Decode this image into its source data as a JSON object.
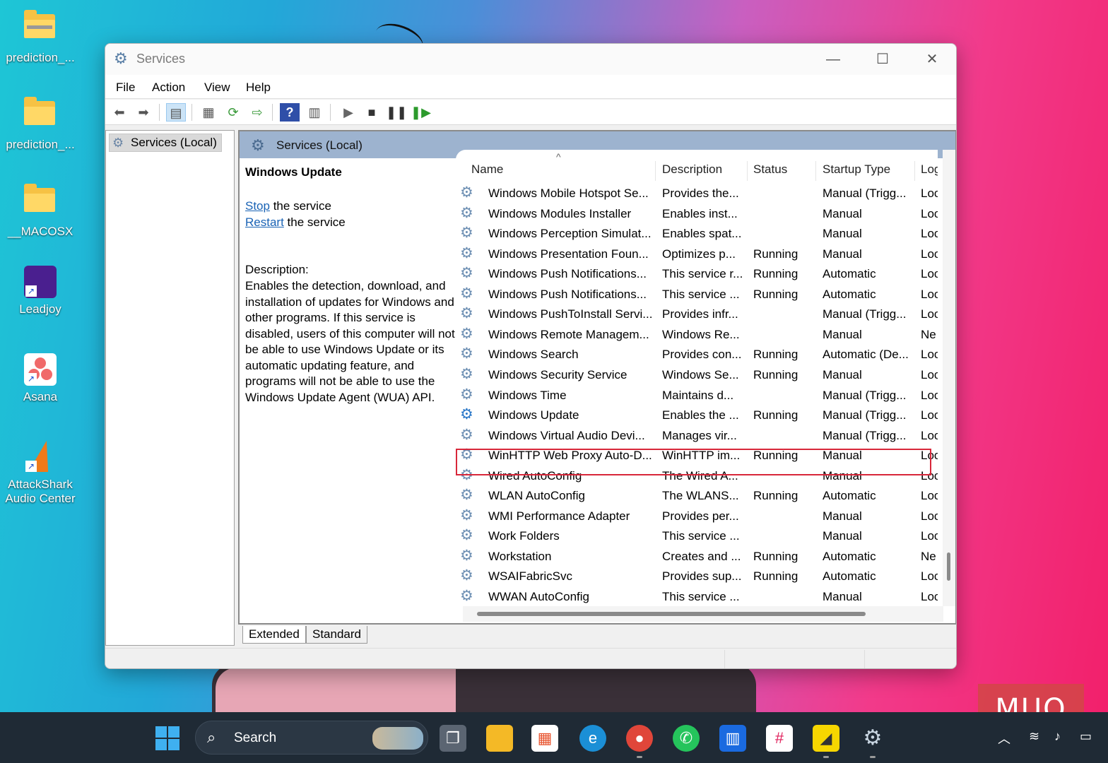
{
  "desktop": {
    "icons": [
      {
        "label": "prediction_...",
        "icon": "zip-folder-icon"
      },
      {
        "label": "prediction_...",
        "icon": "folder-icon"
      },
      {
        "label": "__MACOSX",
        "icon": "folder-icon"
      },
      {
        "label": "Leadjoy",
        "icon": "leadjoy-icon"
      },
      {
        "label": "Asana",
        "icon": "asana-icon"
      },
      {
        "label": "AttackShark Audio Center",
        "icon": "attackshark-icon"
      }
    ]
  },
  "window": {
    "title": "Services",
    "menu": [
      "File",
      "Action",
      "View",
      "Help"
    ],
    "tree_item": "Services (Local)",
    "content_header": "Services (Local)",
    "detail": {
      "service_name": "Windows Update",
      "stop_link": "Stop",
      "stop_rest": " the service",
      "restart_link": "Restart",
      "restart_rest": " the service",
      "description_label": "Description:",
      "description": "Enables the detection, download, and installation of updates for Windows and other programs. If this service is disabled, users of this computer will not be able to use Windows Update or its automatic updating feature, and programs will not be able to use the Windows Update Agent (WUA) API."
    },
    "columns": [
      "Name",
      "Description",
      "Status",
      "Startup Type",
      "Log"
    ],
    "rows": [
      {
        "name": "Windows Mobile Hotspot Se...",
        "description": "Provides the...",
        "status": "",
        "startup": "Manual (Trigg...",
        "logon": "Loc"
      },
      {
        "name": "Windows Modules Installer",
        "description": "Enables inst...",
        "status": "",
        "startup": "Manual",
        "logon": "Loc"
      },
      {
        "name": "Windows Perception Simulat...",
        "description": "Enables spat...",
        "status": "",
        "startup": "Manual",
        "logon": "Loc"
      },
      {
        "name": "Windows Presentation Foun...",
        "description": "Optimizes p...",
        "status": "Running",
        "startup": "Manual",
        "logon": "Loc"
      },
      {
        "name": "Windows Push Notifications...",
        "description": "This service r...",
        "status": "Running",
        "startup": "Automatic",
        "logon": "Loc"
      },
      {
        "name": "Windows Push Notifications...",
        "description": "This service ...",
        "status": "Running",
        "startup": "Automatic",
        "logon": "Loc"
      },
      {
        "name": "Windows PushToInstall Servi...",
        "description": "Provides infr...",
        "status": "",
        "startup": "Manual (Trigg...",
        "logon": "Loc"
      },
      {
        "name": "Windows Remote Managem...",
        "description": "Windows Re...",
        "status": "",
        "startup": "Manual",
        "logon": "Ne"
      },
      {
        "name": "Windows Search",
        "description": "Provides con...",
        "status": "Running",
        "startup": "Automatic (De...",
        "logon": "Loc"
      },
      {
        "name": "Windows Security Service",
        "description": "Windows Se...",
        "status": "Running",
        "startup": "Manual",
        "logon": "Loc"
      },
      {
        "name": "Windows Time",
        "description": "Maintains d...",
        "status": "",
        "startup": "Manual (Trigg...",
        "logon": "Loc"
      },
      {
        "name": "Windows Update",
        "description": "Enables the ...",
        "status": "Running",
        "startup": "Manual (Trigg...",
        "logon": "Loc"
      },
      {
        "name": "Windows Virtual Audio Devi...",
        "description": "Manages vir...",
        "status": "",
        "startup": "Manual (Trigg...",
        "logon": "Loc"
      },
      {
        "name": "WinHTTP Web Proxy Auto-D...",
        "description": "WinHTTP im...",
        "status": "Running",
        "startup": "Manual",
        "logon": "Loc"
      },
      {
        "name": "Wired AutoConfig",
        "description": "The Wired A...",
        "status": "",
        "startup": "Manual",
        "logon": "Loc"
      },
      {
        "name": "WLAN AutoConfig",
        "description": "The WLANS...",
        "status": "Running",
        "startup": "Automatic",
        "logon": "Loc"
      },
      {
        "name": "WMI Performance Adapter",
        "description": "Provides per...",
        "status": "",
        "startup": "Manual",
        "logon": "Loc"
      },
      {
        "name": "Work Folders",
        "description": "This service ...",
        "status": "",
        "startup": "Manual",
        "logon": "Loc"
      },
      {
        "name": "Workstation",
        "description": "Creates and ...",
        "status": "Running",
        "startup": "Automatic",
        "logon": "Ne"
      },
      {
        "name": "WSAIFabricSvc",
        "description": "Provides sup...",
        "status": "Running",
        "startup": "Automatic",
        "logon": "Loc"
      },
      {
        "name": "WWAN AutoConfig",
        "description": "This service ...",
        "status": "",
        "startup": "Manual",
        "logon": "Loc"
      }
    ],
    "selected_row": "Windows Update",
    "tabs": [
      "Extended",
      "Standard"
    ],
    "active_tab": "Extended"
  },
  "taskbar": {
    "search_placeholder": "Search",
    "apps": [
      "start-icon",
      "task-view-icon",
      "file-explorer-icon",
      "microsoft-store-icon",
      "edge-icon",
      "chrome-icon",
      "whatsapp-icon",
      "trello-icon",
      "slack-icon",
      "sticky-notes-icon",
      "services-gear-icon"
    ]
  },
  "watermark": "MUO",
  "colors": {
    "highlight": "#d8273a",
    "link": "#1a63b5",
    "header": "#9db3cf"
  }
}
